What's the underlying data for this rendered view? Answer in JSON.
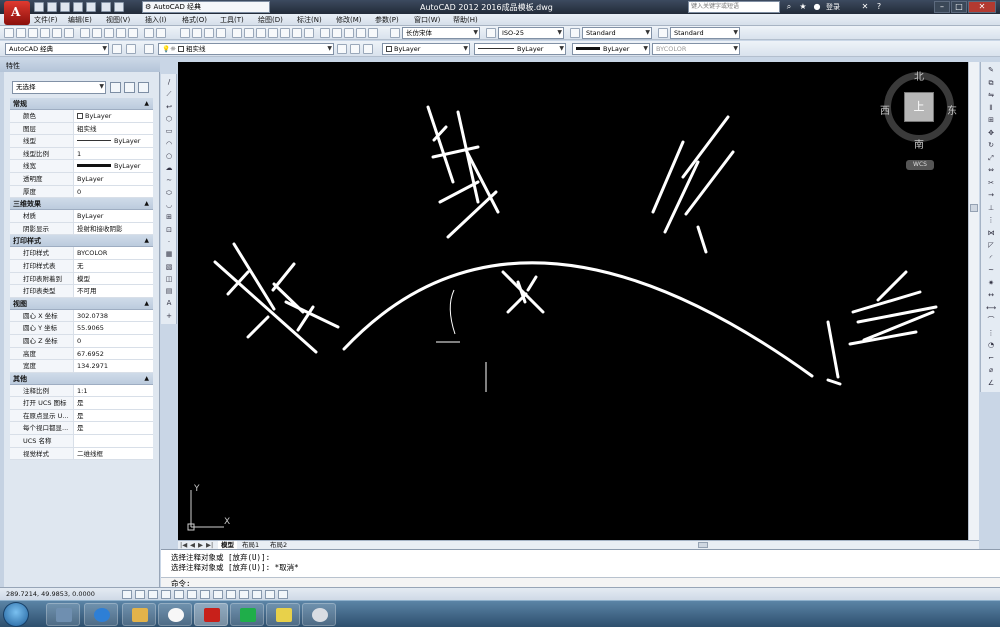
{
  "titlebar": {
    "workspace": "AutoCAD 经典",
    "title": "AutoCAD 2012    2016成品模板.dwg",
    "search_placeholder": "键入关键字或短语",
    "login": "登录"
  },
  "menu": [
    "文件(F)",
    "编辑(E)",
    "视图(V)",
    "插入(I)",
    "格式(O)",
    "工具(T)",
    "绘图(D)",
    "标注(N)",
    "修改(M)",
    "参数(P)",
    "窗口(W)",
    "帮助(H)"
  ],
  "toolbar1": {
    "text_style": "长仿宋体",
    "dim_style": "ISO-25",
    "table_style": "Standard",
    "multileader_style": "Standard"
  },
  "toolbar2": {
    "workspace": "AutoCAD 经典",
    "layer": "粗实线",
    "color": "ByLayer",
    "linetype": "ByLayer",
    "lineweight": "ByLayer",
    "plotstyle": "BYCOLOR"
  },
  "properties": {
    "title": "特性",
    "selection": "无选择",
    "sections": [
      {
        "name": "常规",
        "rows": [
          {
            "k": "颜色",
            "v": "ByLayer",
            "sw": "box"
          },
          {
            "k": "图层",
            "v": "粗实线"
          },
          {
            "k": "线型",
            "v": "ByLayer",
            "sw": "line"
          },
          {
            "k": "线型比例",
            "v": "1"
          },
          {
            "k": "线宽",
            "v": "ByLayer",
            "sw": "thick"
          },
          {
            "k": "透明度",
            "v": "ByLayer"
          },
          {
            "k": "厚度",
            "v": "0"
          }
        ]
      },
      {
        "name": "三维效果",
        "rows": [
          {
            "k": "材质",
            "v": "ByLayer"
          },
          {
            "k": "阴影显示",
            "v": "投射和接收阴影"
          }
        ]
      },
      {
        "name": "打印样式",
        "rows": [
          {
            "k": "打印样式",
            "v": "BYCOLOR"
          },
          {
            "k": "打印样式表",
            "v": "无"
          },
          {
            "k": "打印表附着到",
            "v": "模型"
          },
          {
            "k": "打印表类型",
            "v": "不可用"
          }
        ]
      },
      {
        "name": "视图",
        "rows": [
          {
            "k": "圆心 X 坐标",
            "v": "302.0738"
          },
          {
            "k": "圆心 Y 坐标",
            "v": "55.9065"
          },
          {
            "k": "圆心 Z 坐标",
            "v": "0"
          },
          {
            "k": "高度",
            "v": "67.6952"
          },
          {
            "k": "宽度",
            "v": "134.2971"
          }
        ]
      },
      {
        "name": "其他",
        "rows": [
          {
            "k": "注释比例",
            "v": "1:1"
          },
          {
            "k": "打开 UCS 图标",
            "v": "是"
          },
          {
            "k": "在原点显示 U...",
            "v": "是"
          },
          {
            "k": "每个视口都显...",
            "v": "是"
          },
          {
            "k": "UCS 名称",
            "v": ""
          },
          {
            "k": "视觉样式",
            "v": "二维线框"
          }
        ]
      }
    ]
  },
  "viewcube": {
    "north": "北",
    "south": "南",
    "east": "东",
    "west": "西",
    "top": "上",
    "ucs": "WCS"
  },
  "axis": {
    "x": "X",
    "y": "Y"
  },
  "tabs": [
    "模型",
    "布局1",
    "布局2"
  ],
  "command": {
    "line1": "选择注释对象或 [放弃(U)]:",
    "line2": "选择注释对象或 [放弃(U)]: *取消*",
    "prompt": "命令:"
  },
  "status": {
    "coords": "289.7214, 49.9853, 0.0000"
  },
  "colors": {
    "canvas": "#000000",
    "accent": "#c8201a"
  }
}
